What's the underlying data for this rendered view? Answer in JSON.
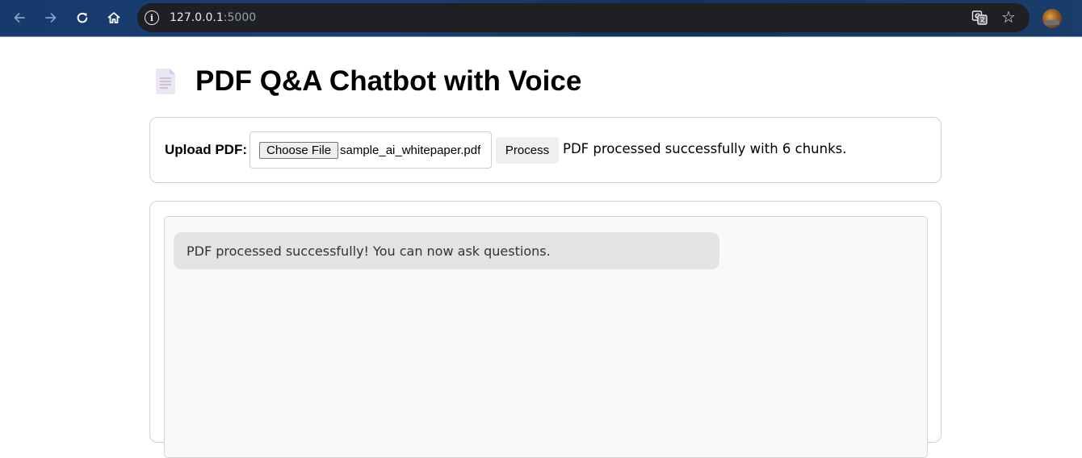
{
  "browser": {
    "url_host": "127.0.0.1",
    "url_port": ":5000",
    "icons": {
      "back": "arrow-left-icon",
      "forward": "arrow-right-icon",
      "reload": "reload-icon",
      "home": "home-icon",
      "site_info": "info-icon",
      "translate": "translate-icon",
      "bookmark": "star-icon",
      "profile": "avatar"
    },
    "info_glyph": "i"
  },
  "page": {
    "title": "PDF Q&A Chatbot with Voice",
    "title_icon": "document-icon"
  },
  "upload": {
    "label": "Upload PDF:",
    "choose_file_label": "Choose File",
    "file_name": "sample_ai_whitepaper.pdf",
    "process_label": "Process",
    "status": "PDF processed successfully with 6 chunks."
  },
  "chat": {
    "messages": [
      {
        "role": "bot",
        "text": "PDF processed successfully! You can now ask questions."
      }
    ]
  },
  "colors": {
    "chrome_bg": "#163a6e",
    "url_bar_bg": "#1f2023",
    "message_bg": "#e3e3e3",
    "chat_log_bg": "#f9f9f9",
    "button_bg": "#efefef"
  }
}
